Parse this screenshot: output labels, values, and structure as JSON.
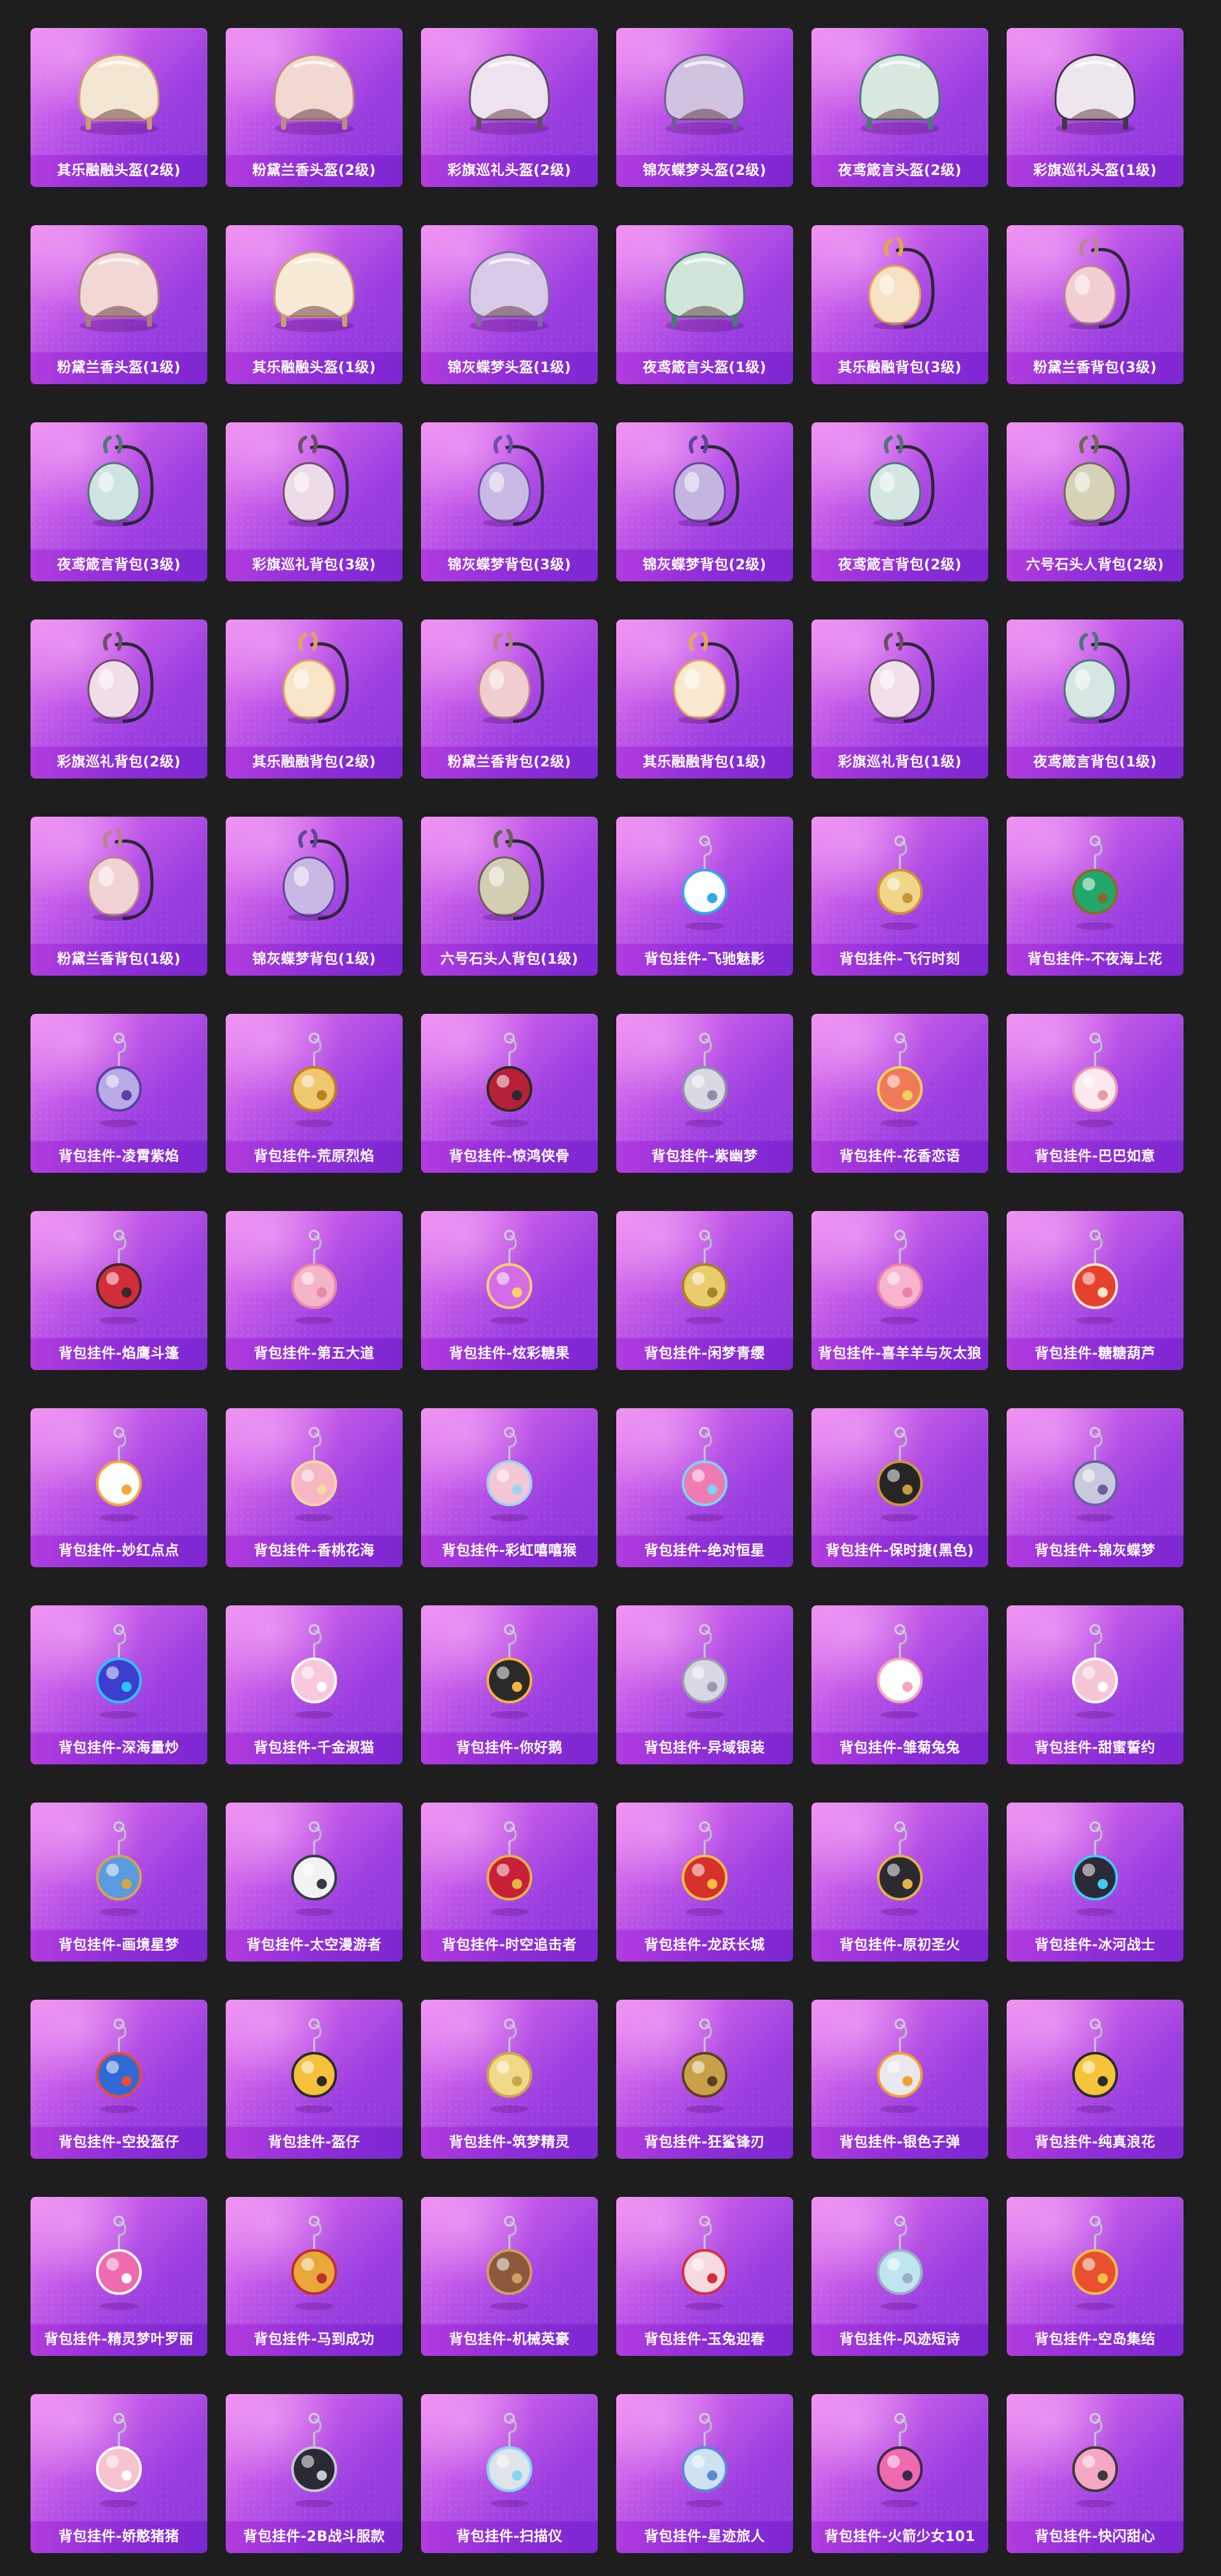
{
  "items": [
    {
      "label": "其乐融融头盔(2级)",
      "icon": "helmet-icon",
      "color": "#f3e7d3",
      "accent": "#c8a06a"
    },
    {
      "label": "粉黛兰香头盔(2级)",
      "icon": "helmet-icon",
      "color": "#f1d9d2",
      "accent": "#b98c82"
    },
    {
      "label": "彩旗巡礼头盔(2级)",
      "icon": "helmet-icon",
      "color": "#ece3ef",
      "accent": "#5c5060"
    },
    {
      "label": "锦灰蝶梦头盔(2级)",
      "icon": "helmet-icon",
      "color": "#cfc3df",
      "accent": "#6f5d95"
    },
    {
      "label": "夜鸢箴言头盔(2级)",
      "icon": "helmet-icon",
      "color": "#d7e8df",
      "accent": "#4c7a78"
    },
    {
      "label": "彩旗巡礼头盔(1级)",
      "icon": "helmet-icon",
      "color": "#eee6ee",
      "accent": "#3e3848"
    },
    {
      "label": "粉黛兰香头盔(1级)",
      "icon": "helmet-icon",
      "color": "#f2d8d4",
      "accent": "#a7807a"
    },
    {
      "label": "其乐融融头盔(1级)",
      "icon": "helmet-icon",
      "color": "#f7ead6",
      "accent": "#c9a16a"
    },
    {
      "label": "锦灰蝶梦头盔(1级)",
      "icon": "helmet-icon",
      "color": "#d8c9e6",
      "accent": "#7b6a9e"
    },
    {
      "label": "夜鸢箴言头盔(1级)",
      "icon": "helmet-icon",
      "color": "#cfe6d8",
      "accent": "#477b6c"
    },
    {
      "label": "其乐融融背包(3级)",
      "icon": "backpack-icon",
      "color": "#f6e2c4",
      "accent": "#e3a64c"
    },
    {
      "label": "粉黛兰香背包(3级)",
      "icon": "backpack-icon",
      "color": "#f2cfd3",
      "accent": "#b98590"
    },
    {
      "label": "夜鸢箴言背包(3级)",
      "icon": "backpack-icon",
      "color": "#cfe4e0",
      "accent": "#4d7878"
    },
    {
      "label": "彩旗巡礼背包(3级)",
      "icon": "backpack-icon",
      "color": "#eedbe8",
      "accent": "#6b5065"
    },
    {
      "label": "锦灰蝶梦背包(3级)",
      "icon": "backpack-icon",
      "color": "#c9b9e4",
      "accent": "#6c4fa8"
    },
    {
      "label": "锦灰蝶梦背包(2级)",
      "icon": "backpack-icon",
      "color": "#c4b4e0",
      "accent": "#5e4698"
    },
    {
      "label": "夜鸢箴言背包(2级)",
      "icon": "backpack-icon",
      "color": "#d3e6e2",
      "accent": "#4a7575"
    },
    {
      "label": "六号石头人背包(2级)",
      "icon": "backpack-icon",
      "color": "#d6d2b8",
      "accent": "#6c6a55"
    },
    {
      "label": "彩旗巡礼背包(2级)",
      "icon": "backpack-icon",
      "color": "#f0dde8",
      "accent": "#6e5066"
    },
    {
      "label": "其乐融融背包(2级)",
      "icon": "backpack-icon",
      "color": "#f7e5c8",
      "accent": "#e0a558"
    },
    {
      "label": "粉黛兰香背包(2级)",
      "icon": "backpack-icon",
      "color": "#f0cdcf",
      "accent": "#b88288"
    },
    {
      "label": "其乐融融背包(1级)",
      "icon": "backpack-icon",
      "color": "#f8e9d0",
      "accent": "#e2a855"
    },
    {
      "label": "彩旗巡礼背包(1级)",
      "icon": "backpack-icon",
      "color": "#f1dfe9",
      "accent": "#6a4e63"
    },
    {
      "label": "夜鸢箴言背包(1级)",
      "icon": "backpack-icon",
      "color": "#d5e7e3",
      "accent": "#4a7676"
    },
    {
      "label": "粉黛兰香背包(1级)",
      "icon": "backpack-icon",
      "color": "#f1d2d2",
      "accent": "#b6858b"
    },
    {
      "label": "锦灰蝶梦背包(1级)",
      "icon": "backpack-icon",
      "color": "#c9b8e3",
      "accent": "#5f479b"
    },
    {
      "label": "六号石头人背包(1级)",
      "icon": "backpack-icon",
      "color": "#d2ceb4",
      "accent": "#65634f"
    },
    {
      "label": "背包挂件-飞驰魅影",
      "icon": "winged-eye-charm-icon",
      "color": "#ffffff",
      "accent": "#33a8e6"
    },
    {
      "label": "背包挂件-飞行时刻",
      "icon": "airplane-charm-icon",
      "color": "#f1d68a",
      "accent": "#c99632"
    },
    {
      "label": "背包挂件-不夜海上花",
      "icon": "jade-charm-icon",
      "color": "#22a86a",
      "accent": "#8a6a2a"
    },
    {
      "label": "背包挂件-凌霄紫焰",
      "icon": "flame-charm-icon",
      "color": "#b9a9e6",
      "accent": "#5b3fa6"
    },
    {
      "label": "背包挂件-荒原烈焰",
      "icon": "sun-charm-icon",
      "color": "#f0c66e",
      "accent": "#b9801f"
    },
    {
      "label": "背包挂件-惊鸿侠骨",
      "icon": "tassel-charm-icon",
      "color": "#b8203a",
      "accent": "#2a2a2a"
    },
    {
      "label": "背包挂件-紫幽梦",
      "icon": "bell-charm-icon",
      "color": "#d9d9e3",
      "accent": "#8e8ea6"
    },
    {
      "label": "背包挂件-花香恋语",
      "icon": "amulet-charm-icon",
      "color": "#ef7a5a",
      "accent": "#f1d25a"
    },
    {
      "label": "背包挂件-巴巴如意",
      "icon": "cat-charm-icon",
      "color": "#fbe9ef",
      "accent": "#e89aa8"
    },
    {
      "label": "背包挂件-焰鹰斗篷",
      "icon": "flower-charm-icon",
      "color": "#d22e3a",
      "accent": "#3a2a26"
    },
    {
      "label": "背包挂件-第五大道",
      "icon": "heart-charm-icon",
      "color": "#f5b5c9",
      "accent": "#e58aa7"
    },
    {
      "label": "背包挂件-炫彩糖果",
      "icon": "candy-charm-icon",
      "color": "#d66be8",
      "accent": "#f5d36a"
    },
    {
      "label": "背包挂件-闲梦青缨",
      "icon": "hairpin-charm-icon",
      "color": "#e9cc6b",
      "accent": "#a98422"
    },
    {
      "label": "背包挂件-喜羊羊与灰太狼",
      "icon": "bow-charm-icon",
      "color": "#f7b4cf",
      "accent": "#e883a7"
    },
    {
      "label": "背包挂件-糖糖葫芦",
      "icon": "gourd-charm-icon",
      "color": "#e8402e",
      "accent": "#f6e7c8"
    },
    {
      "label": "背包挂件-妙红点点",
      "icon": "daisy-charm-icon",
      "color": "#ffffff",
      "accent": "#f2a93a"
    },
    {
      "label": "背包挂件-香桃花海",
      "icon": "peach-blossom-charm-icon",
      "color": "#f7b6c4",
      "accent": "#f1d9a0"
    },
    {
      "label": "背包挂件-彩虹嘻嘻猴",
      "icon": "rainbow-charm-icon",
      "color": "#f3c7d5",
      "accent": "#9ed4f0"
    },
    {
      "label": "背包挂件-绝对恒星",
      "icon": "camera-charm-icon",
      "color": "#f07ab2",
      "accent": "#7ad4f2"
    },
    {
      "label": "背包挂件-保时捷(黑色)",
      "icon": "car-key-charm-icon",
      "color": "#262626",
      "accent": "#c89a3a"
    },
    {
      "label": "背包挂件-锦灰蝶梦",
      "icon": "axe-charm-icon",
      "color": "#c9c9de",
      "accent": "#6a5ea6"
    },
    {
      "label": "背包挂件-深海量炒",
      "icon": "submarine-charm-icon",
      "color": "#3d3ed0",
      "accent": "#2cc4ff"
    },
    {
      "label": "背包挂件-千金淑猫",
      "icon": "kitten-charm-icon",
      "color": "#f9c8dc",
      "accent": "#ffffff"
    },
    {
      "label": "背包挂件-你好鹅",
      "icon": "penguin-charm-icon",
      "color": "#2a2a2a",
      "accent": "#f5b43a"
    },
    {
      "label": "背包挂件-异域银装",
      "icon": "silver-wings-charm-icon",
      "color": "#d8d8e4",
      "accent": "#9a9ab0"
    },
    {
      "label": "背包挂件-雏菊兔兔",
      "icon": "bunny-charm-icon",
      "color": "#ffffff",
      "accent": "#f5a7b8"
    },
    {
      "label": "背包挂件-甜蜜誓约",
      "icon": "pink-bunny-charm-icon",
      "color": "#f6c6d6",
      "accent": "#ffffff"
    },
    {
      "label": "背包挂件-画境星梦",
      "icon": "brush-charm-icon",
      "color": "#5a9be0",
      "accent": "#d4a64a"
    },
    {
      "label": "背包挂件-太空漫游者",
      "icon": "astronaut-charm-icon",
      "color": "#f2f2f2",
      "accent": "#3a3a48"
    },
    {
      "label": "背包挂件-时空追击者",
      "icon": "crown-charm-icon",
      "color": "#c82038",
      "accent": "#e3b446"
    },
    {
      "label": "背包挂件-龙跃长城",
      "icon": "lion-charm-icon",
      "color": "#d8302a",
      "accent": "#f2c043"
    },
    {
      "label": "背包挂件-原初圣火",
      "icon": "emblem-charm-icon",
      "color": "#2a2a30",
      "accent": "#e3b446"
    },
    {
      "label": "背包挂件-冰河战士",
      "icon": "robot-charm-icon",
      "color": "#2a2a38",
      "accent": "#42c8f2"
    },
    {
      "label": "背包挂件-空投盔仔",
      "icon": "robot-head-charm-icon",
      "color": "#2f6ad4",
      "accent": "#e84c3a"
    },
    {
      "label": "背包挂件-盔仔",
      "icon": "chick-charm-icon",
      "color": "#f5c03a",
      "accent": "#2a2a2a"
    },
    {
      "label": "背包挂件-筑梦精灵",
      "icon": "butterfly-charm-icon",
      "color": "#f1d98a",
      "accent": "#c9a84a"
    },
    {
      "label": "背包挂件-狂鲨锋刃",
      "icon": "blade-charm-icon",
      "color": "#c8a048",
      "accent": "#5a4020"
    },
    {
      "label": "背包挂件-银色子弹",
      "icon": "walkie-talkie-charm-icon",
      "color": "#e8e8ee",
      "accent": "#f0a030"
    },
    {
      "label": "背包挂件-纯真浪花",
      "icon": "wrench-charm-icon",
      "color": "#f5c43a",
      "accent": "#2a2a2a"
    },
    {
      "label": "背包挂件-精灵梦叶罗丽",
      "icon": "winged-heart-charm-icon",
      "color": "#f06ab0",
      "accent": "#ffffff"
    },
    {
      "label": "背包挂件-马到成功",
      "icon": "rocking-horse-charm-icon",
      "color": "#e8a83a",
      "accent": "#c0302a"
    },
    {
      "label": "背包挂件-机械英豪",
      "icon": "goggles-charm-icon",
      "color": "#8a5a3a",
      "accent": "#d0a060"
    },
    {
      "label": "背包挂件-玉兔迎春",
      "icon": "rabbit-charm-icon",
      "color": "#f6dadf",
      "accent": "#d4303a"
    },
    {
      "label": "背包挂件-风迹短诗",
      "icon": "card-charm-icon",
      "color": "#bfe6ef",
      "accent": "#9ab0c4"
    },
    {
      "label": "背包挂件-空岛集结",
      "icon": "gun-charm-icon",
      "color": "#e8502e",
      "accent": "#f0c04a"
    },
    {
      "label": "背包挂件-娇憨猪猪",
      "icon": "pig-charm-icon",
      "color": "#f6c3cf",
      "accent": "#ffffff"
    },
    {
      "label": "背包挂件-2B战斗服款",
      "icon": "sword-charm-icon",
      "color": "#2a2a34",
      "accent": "#c8c8d4"
    },
    {
      "label": "背包挂件-扫描仪",
      "icon": "ghost-shell-charm-icon",
      "color": "#dfe3ea",
      "accent": "#8ad4f2"
    },
    {
      "label": "背包挂件-星迹旅人",
      "icon": "rocket-charm-icon",
      "color": "#cfe2f2",
      "accent": "#5a8ad4"
    },
    {
      "label": "背包挂件-火箭少女101",
      "icon": "pink-rocket-charm-icon",
      "color": "#f06ab0",
      "accent": "#3a2a48"
    },
    {
      "label": "背包挂件-快闪甜心",
      "icon": "donut-charm-icon",
      "color": "#f6a7c4",
      "accent": "#3a3a3a"
    }
  ]
}
